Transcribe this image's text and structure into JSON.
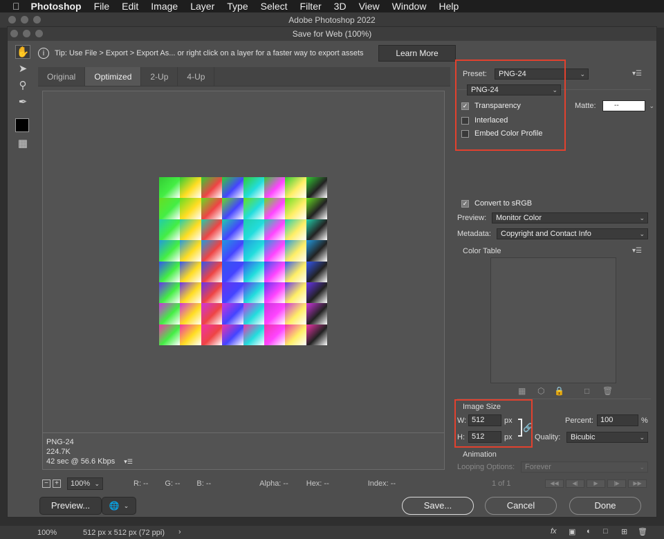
{
  "menubar": {
    "apple": "",
    "app_name": "Photoshop",
    "items": [
      "File",
      "Edit",
      "Image",
      "Layer",
      "Type",
      "Select",
      "Filter",
      "3D",
      "View",
      "Window",
      "Help"
    ]
  },
  "ps_window_title": "Adobe Photoshop 2022",
  "dialog": {
    "title": "Save for Web (100%)",
    "tip": "Tip: Use File > Export > Export As...  or right click on a layer for a faster way to export assets",
    "learn_more": "Learn More",
    "tabs": [
      {
        "label": "Original",
        "active": false
      },
      {
        "label": "Optimized",
        "active": true
      },
      {
        "label": "2-Up",
        "active": false
      },
      {
        "label": "4-Up",
        "active": false
      }
    ],
    "image_info": {
      "format": "PNG-24",
      "size": "224.7K",
      "download": "42 sec @ 56.6 Kbps"
    },
    "bottom_bar": {
      "zoom": "100%",
      "r": "R: --",
      "g": "G: --",
      "b": "B: --",
      "alpha": "Alpha: --",
      "hex": "Hex: --",
      "index": "Index: --"
    },
    "buttons": {
      "preview": "Preview...",
      "save": "Save...",
      "cancel": "Cancel",
      "done": "Done"
    },
    "settings": {
      "preset_label": "Preset:",
      "preset_value": "PNG-24",
      "format_value": "PNG-24",
      "transparency_label": "Transparency",
      "transparency_checked": true,
      "matte_label": "Matte:",
      "matte_value": "--",
      "interlaced_label": "Interlaced",
      "interlaced_checked": false,
      "embed_profile_label": "Embed Color Profile",
      "embed_profile_checked": false,
      "convert_srgb_label": "Convert to sRGB",
      "convert_srgb_checked": true,
      "preview_label": "Preview:",
      "preview_value": "Monitor Color",
      "metadata_label": "Metadata:",
      "metadata_value": "Copyright and Contact Info",
      "color_table_label": "Color Table"
    },
    "image_size": {
      "heading": "Image Size",
      "w_label": "W:",
      "w_value": "512",
      "h_label": "H:",
      "h_value": "512",
      "unit": "px",
      "percent_label": "Percent:",
      "percent_value": "100",
      "percent_unit": "%",
      "quality_label": "Quality:",
      "quality_value": "Bicubic"
    },
    "animation": {
      "heading": "Animation",
      "looping_label": "Looping Options:",
      "looping_value": "Forever",
      "frame_counter": "1 of 1"
    }
  },
  "footer": {
    "zoom": "100%",
    "doc_size": "512 px x 512 px (72 ppi)"
  },
  "colors": {
    "highlight_box": "#e2412e",
    "dialog_bg": "#4e4e4e"
  }
}
